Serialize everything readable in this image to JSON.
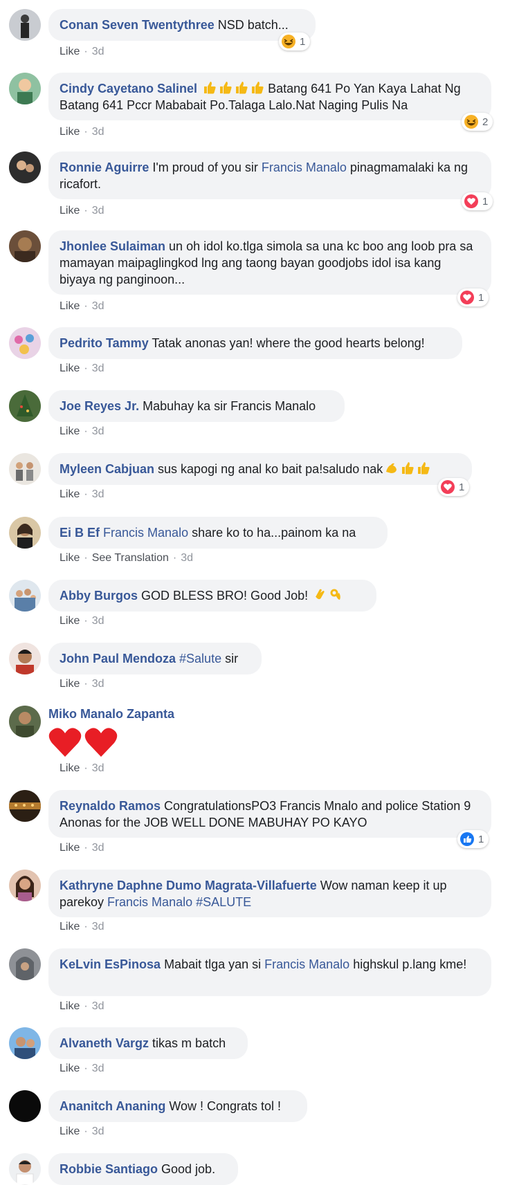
{
  "colors": {
    "author": "#385898",
    "bubble": "#f2f3f5",
    "meta": "#90949c",
    "heart": "#f33e58",
    "haha": "#f7b125",
    "like": "#1877f2"
  },
  "labels": {
    "like": "Like",
    "see_translation": "See Translation"
  },
  "comments": [
    {
      "author": "Conan Seven Twentythree",
      "pre": " NSD batch...",
      "time": "3d",
      "reaction": {
        "icon": "haha-reaction-icon",
        "count": "1"
      }
    },
    {
      "author": "Cindy Cayetano Salinel",
      "pre": " Batang 641 Po Yan Kaya Lahat Ng Batang 641 Pccr Mababait Po.Talaga Lalo.Nat Naging Pulis Na",
      "time": "3d",
      "reaction": {
        "icon": "haha-reaction-icon",
        "count": "2"
      },
      "emojis": [
        "thumbs-up",
        "thumbs-up",
        "thumbs-up",
        "thumbs-up"
      ]
    },
    {
      "author": "Ronnie Aguirre",
      "pre": " I'm proud of you sir ",
      "mention": "Francis Manalo",
      "post": " pinagmamalaki ka ng ricafort.",
      "time": "3d",
      "reaction": {
        "icon": "love-reaction-icon",
        "count": "1"
      }
    },
    {
      "author": "Jhonlee Sulaiman",
      "pre": " un oh idol ko.tlga simola sa una kc boo ang loob pra sa mamayan maipaglingkod lng ang taong bayan goodjobs idol isa kang biyaya ng panginoon...",
      "time": "3d",
      "reaction": {
        "icon": "love-reaction-icon",
        "count": "1"
      }
    },
    {
      "author": "Pedrito Tammy",
      "pre": " Tatak anonas yan! where the good hearts belong!",
      "time": "3d"
    },
    {
      "author": "Joe Reyes Jr.",
      "pre": " Mabuhay ka sir Francis Manalo",
      "time": "3d"
    },
    {
      "author": "Myleen Cabjuan",
      "pre": " sus kapogi ng anal ko bait pa!saludo nak",
      "time": "3d",
      "reaction": {
        "icon": "love-reaction-icon",
        "count": "1"
      },
      "emojis_after": [
        "flexed-biceps",
        "thumbs-up",
        "thumbs-up"
      ]
    },
    {
      "author": "Ei B Ef",
      "pre": " ",
      "mention": "Francis Manalo",
      "post": " share ko to ha...painom ka na",
      "time": "3d",
      "translation": true
    },
    {
      "author": "Abby Burgos",
      "pre": " GOD BLESS BRO! Good Job! ",
      "time": "3d",
      "emojis_after": [
        "clapping-hands",
        "ok-hand"
      ]
    },
    {
      "author": "John Paul Mendoza",
      "pre": " ",
      "mention": "#Salute",
      "post": " sir",
      "time": "3d"
    },
    {
      "author": "Miko Manalo Zapanta",
      "time": "3d",
      "big_hearts": 2
    },
    {
      "author": "Reynaldo Ramos",
      "pre": " CongratulationsPO3 Francis Mnalo and police Station 9 Anonas for the JOB WELL DONE MABUHAY PO KAYO",
      "time": "3d",
      "reaction": {
        "icon": "like-reaction-icon",
        "count": "1"
      }
    },
    {
      "author": "Kathryne Daphne Dumo Magrata-Villafuerte",
      "pre": " Wow naman keep it up parekoy ",
      "mention": "Francis Manalo",
      "post": " ",
      "mention2": "#SALUTE",
      "time": "3d"
    },
    {
      "author": "KeLvin EsPinosa",
      "pre": " Mabait tlga yan si ",
      "mention": "Francis Manalo",
      "post": " highskul p.lang kme!",
      "time": "3d"
    },
    {
      "author": "Alvaneth Vargz",
      "pre": " tikas m batch",
      "time": "3d"
    },
    {
      "author": "Ananitch Ananing",
      "pre": " Wow ! Congrats tol !",
      "time": "3d"
    },
    {
      "author": "Robbie Santiago",
      "pre": " Good job.",
      "time": ""
    }
  ]
}
